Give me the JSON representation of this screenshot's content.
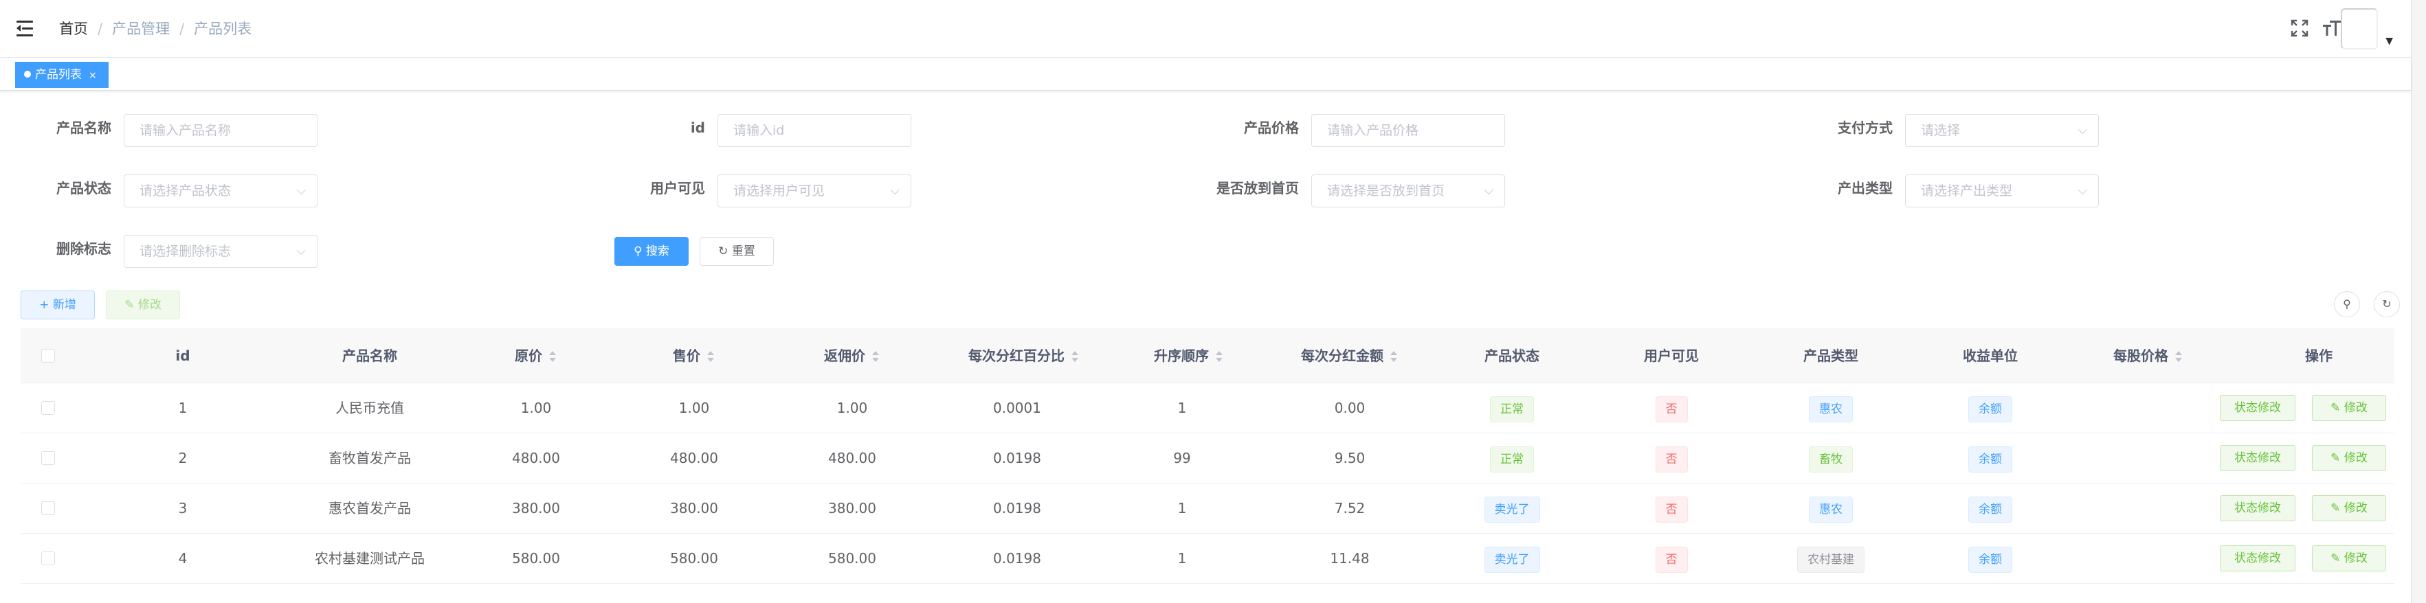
{
  "header": {
    "breadcrumb": [
      "首页",
      "产品管理",
      "产品列表"
    ],
    "separator": "/",
    "icons": [
      "hamburger-icon",
      "fullscreen-icon",
      "font-size-icon",
      "avatar-image",
      "caret-down-icon"
    ]
  },
  "tags_view": {
    "active_tag": "产品列表",
    "close": "×"
  },
  "search_form": {
    "product_name": {
      "label": "产品名称",
      "placeholder": "请输入产品名称"
    },
    "id": {
      "label": "id",
      "placeholder": "请输入id"
    },
    "price": {
      "label": "产品价格",
      "placeholder": "请输入产品价格"
    },
    "pay_method": {
      "label": "支付方式",
      "placeholder": "请选择"
    },
    "status": {
      "label": "产品状态",
      "placeholder": "请选择产品状态"
    },
    "user_visible": {
      "label": "用户可见",
      "placeholder": "请选择用户可见"
    },
    "on_home": {
      "label": "是否放到首页",
      "placeholder": "请选择是否放到首页"
    },
    "output_type": {
      "label": "产出类型",
      "placeholder": "请选择产出类型"
    },
    "delete_flag": {
      "label": "删除标志",
      "placeholder": "请选择删除标志"
    },
    "search_button": "搜索",
    "reset_button": "重置"
  },
  "toolbar": {
    "add_button": "新增",
    "edit_button": "修改"
  },
  "table": {
    "columns": [
      "id",
      "产品名称",
      "原价",
      "售价",
      "返佣价",
      "每次分红百分比",
      "升序顺序",
      "每次分红金额",
      "产品状态",
      "用户可见",
      "产品类型",
      "收益单位",
      "每股价格",
      "操作"
    ],
    "rows": [
      {
        "id": "1",
        "name": "人民币充值",
        "original": "1.00",
        "sale": "1.00",
        "rebate": "1.00",
        "percent": "0.0001",
        "order": "1",
        "amount": "0.00",
        "status": "正常",
        "visible": "否",
        "type": "惠农",
        "unit": "余额",
        "share_price": "",
        "status_btn": "状态修改",
        "edit_btn": "修改"
      },
      {
        "id": "2",
        "name": "畜牧首发产品",
        "original": "480.00",
        "sale": "480.00",
        "rebate": "480.00",
        "percent": "0.0198",
        "order": "99",
        "amount": "9.50",
        "status": "正常",
        "visible": "否",
        "type": "畜牧",
        "unit": "余额",
        "share_price": "",
        "status_btn": "状态修改",
        "edit_btn": "修改"
      },
      {
        "id": "3",
        "name": "惠农首发产品",
        "original": "380.00",
        "sale": "380.00",
        "rebate": "380.00",
        "percent": "0.0198",
        "order": "1",
        "amount": "7.52",
        "status": "卖光了",
        "visible": "否",
        "type": "惠农",
        "unit": "余额",
        "share_price": "",
        "status_btn": "状态修改",
        "edit_btn": "修改"
      },
      {
        "id": "4",
        "name": "农村基建测试产品",
        "original": "580.00",
        "sale": "580.00",
        "rebate": "580.00",
        "percent": "0.0198",
        "order": "1",
        "amount": "11.48",
        "status": "卖光了",
        "visible": "否",
        "type": "农村基建",
        "unit": "余额",
        "share_price": "",
        "status_btn": "状态修改",
        "edit_btn": "修改"
      }
    ]
  },
  "colors": {
    "primary": "#409eff",
    "success": "#67c23a",
    "danger": "#f56c6c",
    "info": "#909399"
  }
}
